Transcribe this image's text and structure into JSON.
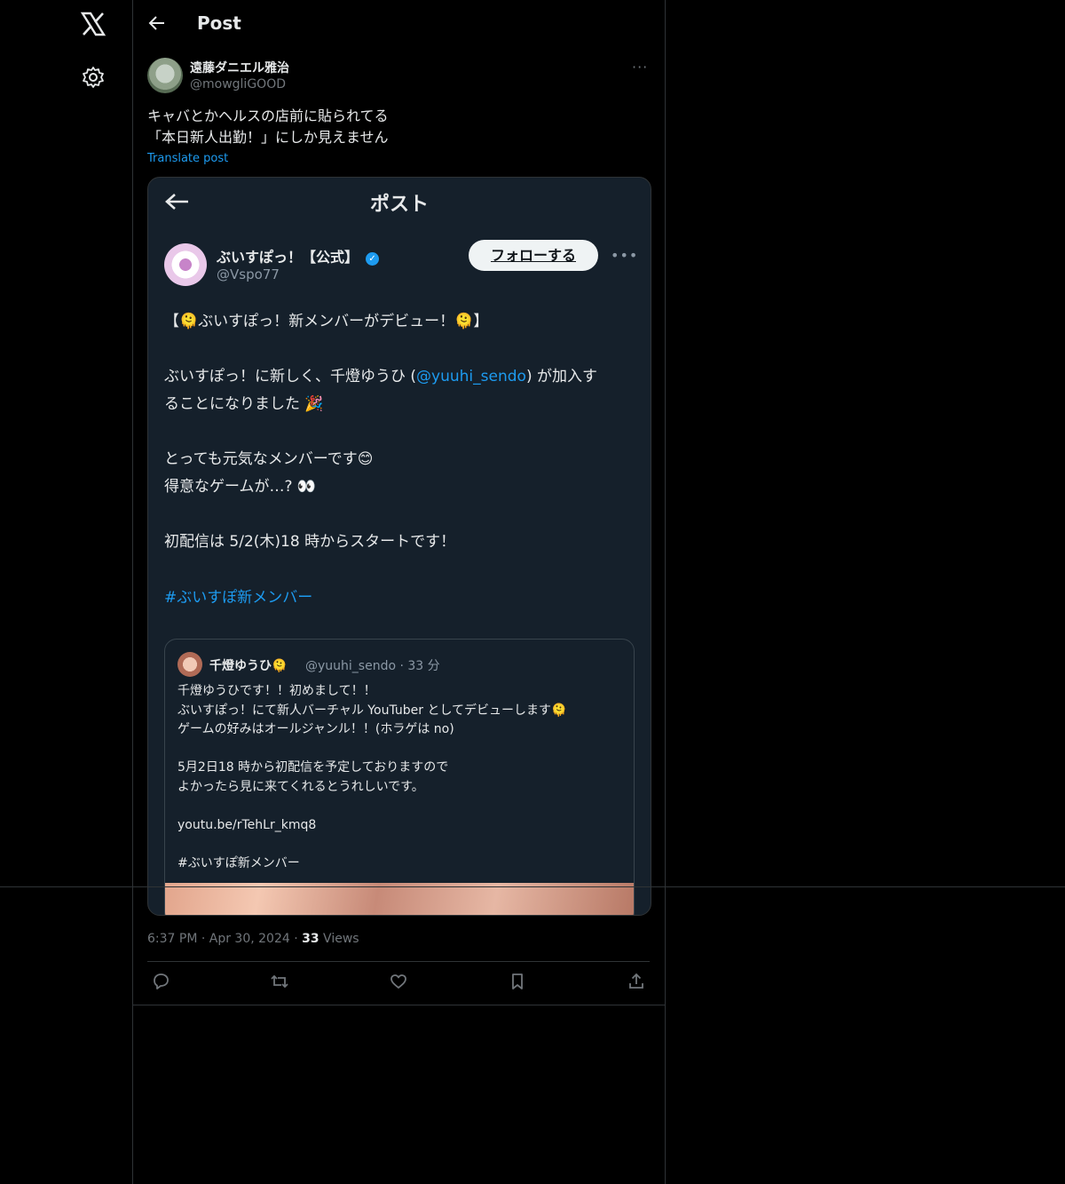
{
  "nav": {
    "logo_icon": "x-logo-icon",
    "settings_icon": "gear-icon"
  },
  "header": {
    "title": "Post",
    "back_icon": "arrow-left-icon"
  },
  "post": {
    "author_name": "遠藤ダニエル雅治",
    "author_handle": "@mowgliGOOD",
    "text": "キャバとかヘルスの店前に貼られてる\n「本日新人出勤！」にしか見えません",
    "translate_label": "Translate post",
    "timestamp": "6:37 PM · Apr 30, 2024 · ",
    "views_count": "33",
    "views_label": " Views"
  },
  "embedded_screenshot": {
    "title": "ポスト",
    "account_name": "ぶいすぽっ！【公式】",
    "account_handle": "@Vspo77",
    "follow_label": "フォローする",
    "body_line1": "【🫠ぶいすぽっ！新メンバーがデビュー！🫠】",
    "body_line2a": "ぶいすぽっ！に新しく、千燈ゆうひ (",
    "mention": "@yuuhi_sendo",
    "body_line2b": ") が加入す\nることになりました 🎉",
    "body_line3": "とっても元気なメンバーです😊\n得意なゲームが…? 👀",
    "body_line4": "初配信は 5/2(木)18 時からスタートです！",
    "hashtag": "#ぶいすぽ新メンバー",
    "quote": {
      "name": "千燈ゆうひ🫠",
      "meta": "@yuuhi_sendo · 33 分",
      "body": "千燈ゆうひです！！初めまして！！\nぶいすぽっ！にて新人バーチャル YouTuber としてデビューします🫠\nゲームの好みはオールジャンル！！(ホラゲは no)\n\n5月2日18 時から初配信を予定しておりますので\nよかったら見に来てくれるとうれしいです。\n\nyoutu.be/rTehLr_kmq8\n\n#ぶいすぽ新メンバー"
    }
  },
  "actions": [
    "reply-icon",
    "repost-icon",
    "like-icon",
    "bookmark-icon",
    "share-icon"
  ]
}
